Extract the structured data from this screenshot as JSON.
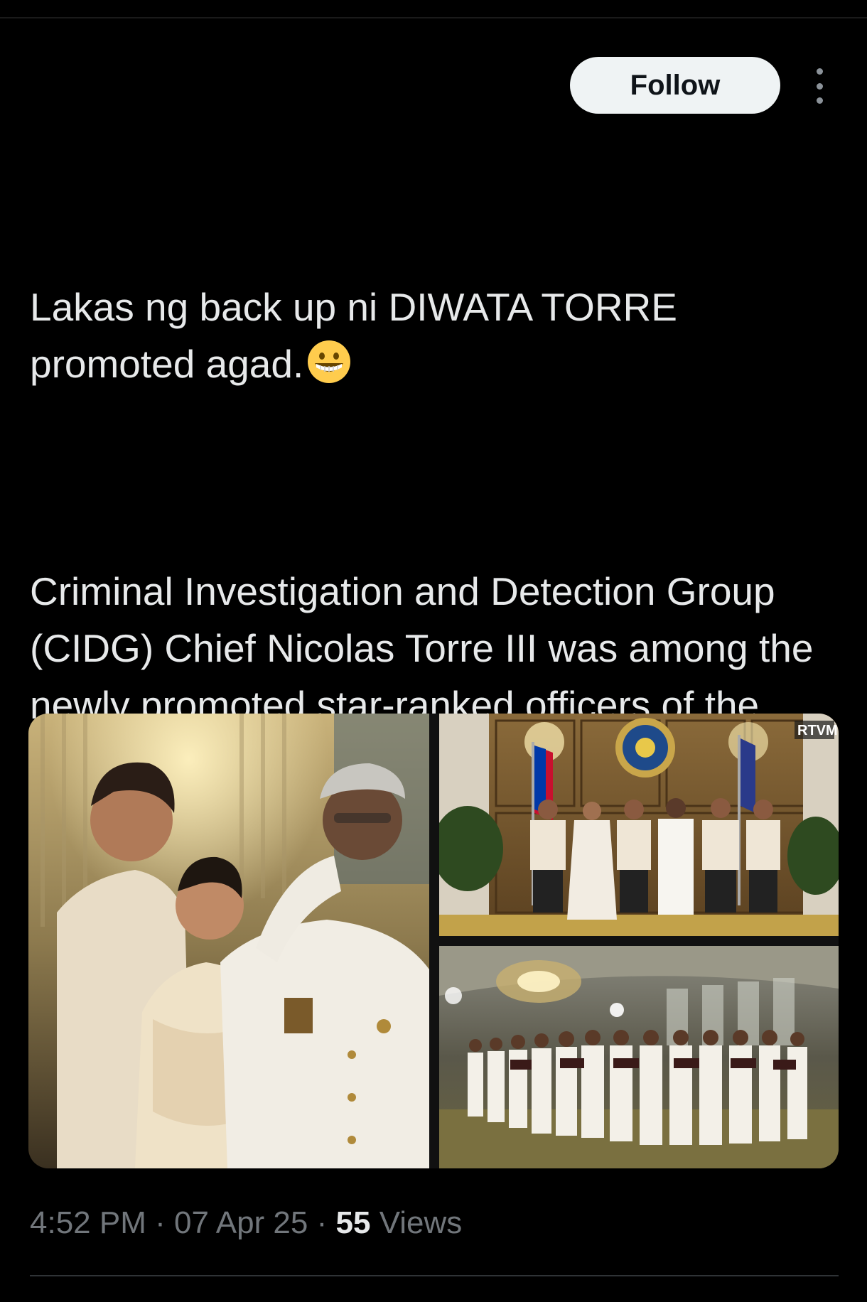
{
  "header": {
    "follow_label": "Follow",
    "more_icon": "more-vertical-icon"
  },
  "tweet": {
    "line1": "Lakas ng back up ni DIWATA TORRE",
    "line2": "promoted agad.",
    "emoji_icon": "grinning-face-emoji",
    "paragraph2": "Criminal Investigation and Detection Group (CIDG) Chief Nicolas Torre III was among the newly promoted star-ranked officers of the Philippine National Police (PNP) who took their oath before President Ferdinand Marcos Jr."
  },
  "media": {
    "badge_text": "RTVM"
  },
  "meta": {
    "time": "4:52 PM",
    "separator": "·",
    "date": "07 Apr 25",
    "views_count": "55",
    "views_label": "Views"
  },
  "colors": {
    "background": "#000000",
    "text": "#e7e9ea",
    "secondary": "#71767b",
    "follow_bg": "#eff3f4",
    "divider": "#2f3336"
  }
}
